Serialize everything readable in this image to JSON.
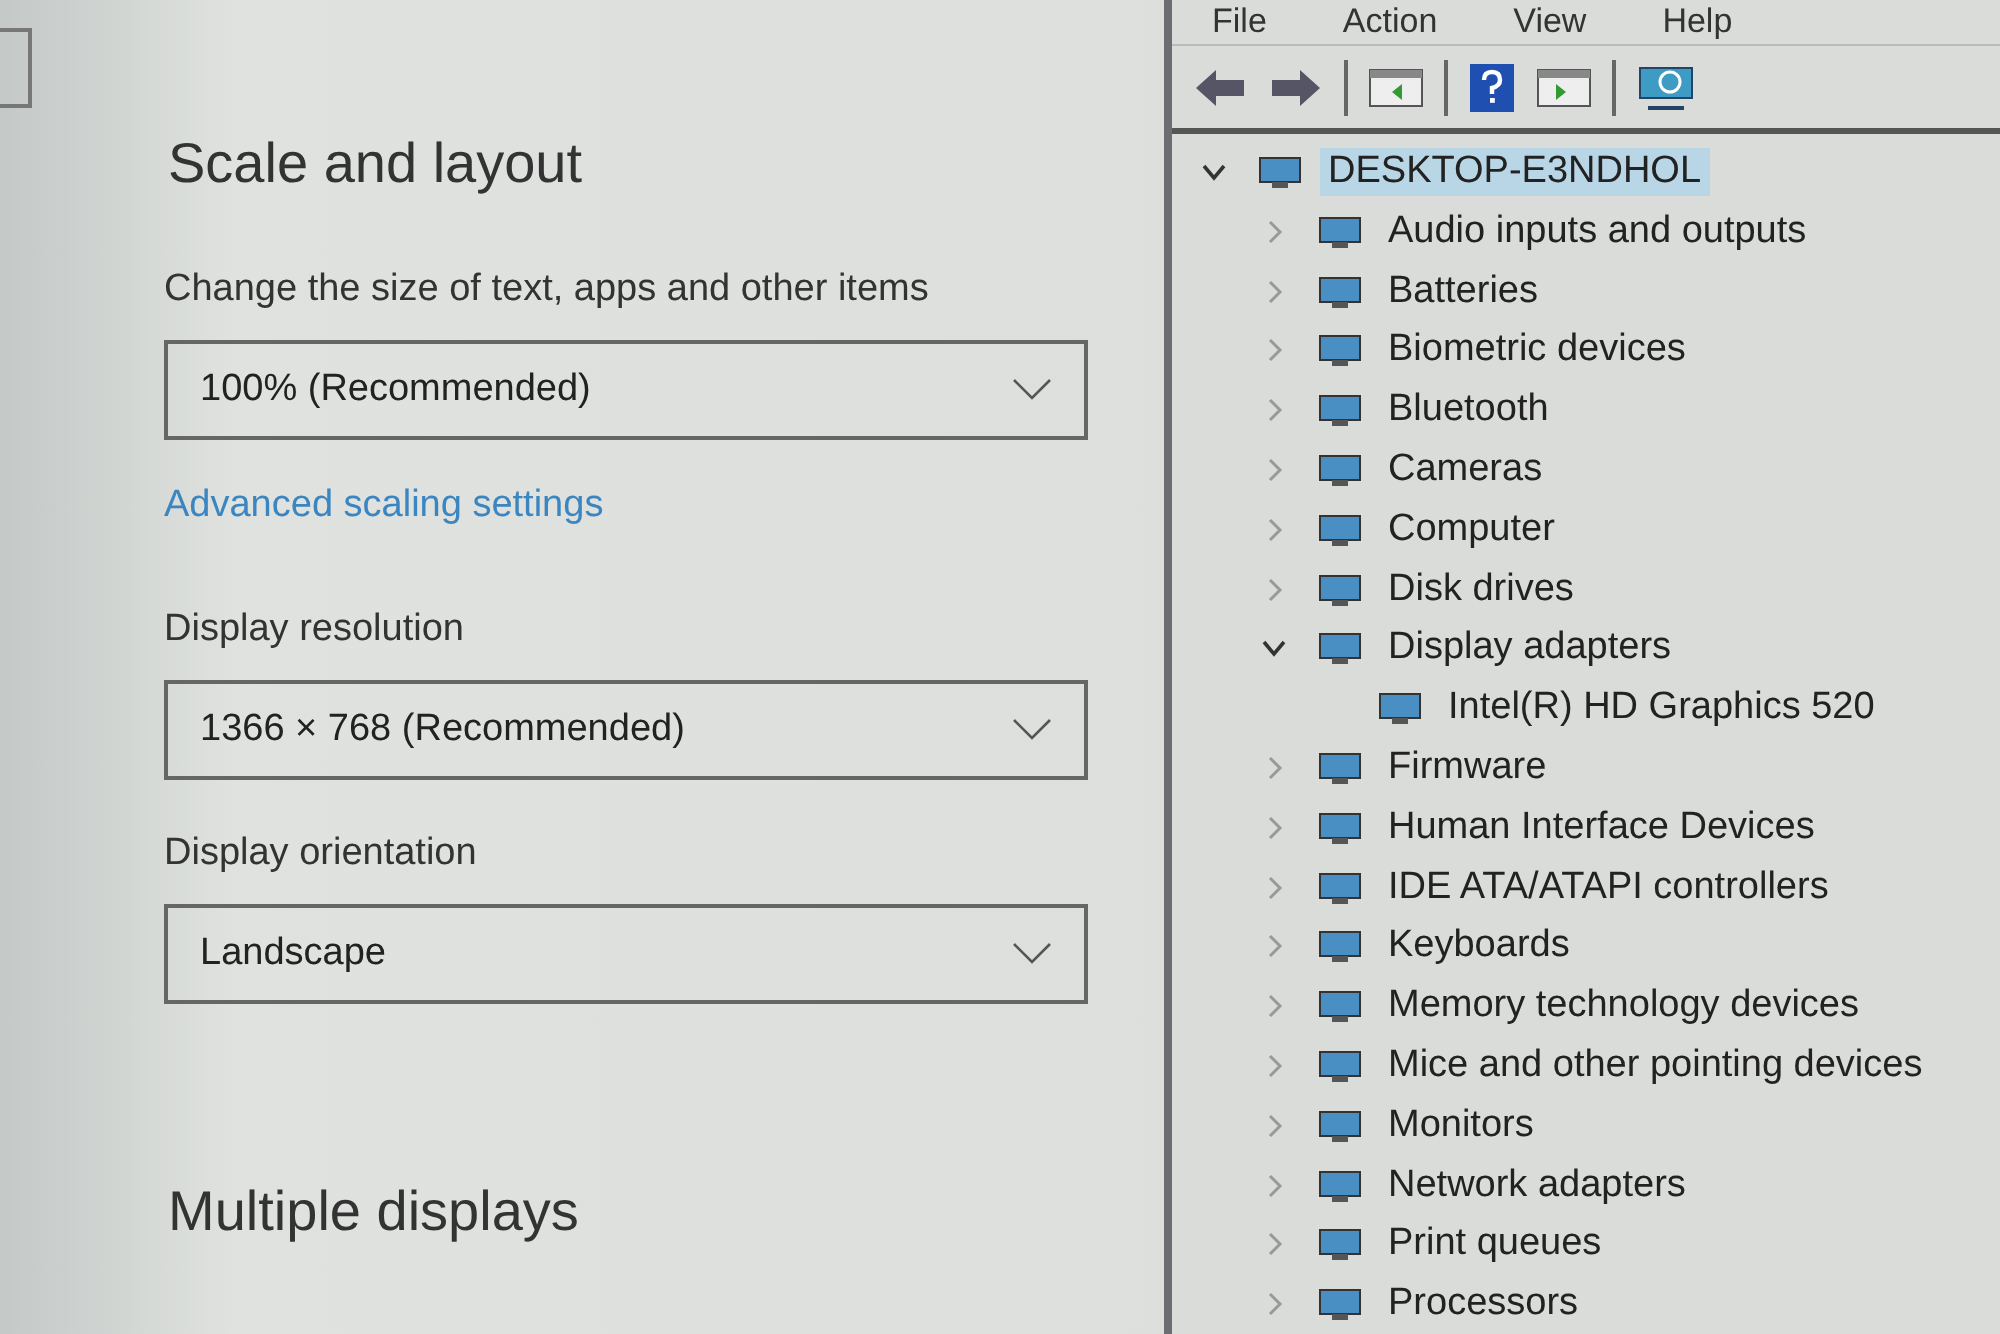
{
  "settings": {
    "heading": "Scale and layout",
    "scale_label": "Change the size of text, apps and other items",
    "scale_value": "100% (Recommended)",
    "advanced_link": "Advanced scaling settings",
    "resolution_label": "Display resolution",
    "resolution_value": "1366 × 768 (Recommended)",
    "orientation_label": "Display orientation",
    "orientation_value": "Landscape",
    "section_heading": "Multiple displays"
  },
  "device_manager": {
    "menu": [
      "File",
      "Action",
      "View",
      "Help"
    ],
    "tree": [
      {
        "label": "DESKTOP-E3NDHOL",
        "expanded": true,
        "selected": true,
        "children": [
          {
            "label": "Audio inputs and outputs",
            "expanded": false,
            "selected": false
          },
          {
            "label": "Batteries",
            "expanded": false,
            "selected": false
          },
          {
            "label": "Biometric devices",
            "expanded": false,
            "selected": false
          },
          {
            "label": "Bluetooth",
            "expanded": false,
            "selected": false
          },
          {
            "label": "Cameras",
            "expanded": false,
            "selected": false
          },
          {
            "label": "Computer",
            "expanded": false,
            "selected": false
          },
          {
            "label": "Disk drives",
            "expanded": false,
            "selected": false
          },
          {
            "label": "Display adapters",
            "expanded": true,
            "selected": false,
            "children": [
              {
                "label": "Intel(R) HD Graphics 520",
                "selected": false
              }
            ]
          },
          {
            "label": "Firmware",
            "expanded": false,
            "selected": false
          },
          {
            "label": "Human Interface Devices",
            "expanded": false,
            "selected": false
          },
          {
            "label": "IDE ATA/ATAPI controllers",
            "expanded": false,
            "selected": false
          },
          {
            "label": "Keyboards",
            "expanded": false,
            "selected": false
          },
          {
            "label": "Memory technology devices",
            "expanded": false,
            "selected": false
          },
          {
            "label": "Mice and other pointing devices",
            "expanded": false,
            "selected": false
          },
          {
            "label": "Monitors",
            "expanded": false,
            "selected": false
          },
          {
            "label": "Network adapters",
            "expanded": false,
            "selected": false
          },
          {
            "label": "Print queues",
            "expanded": false,
            "selected": false
          },
          {
            "label": "Processors",
            "expanded": false,
            "selected": false
          }
        ]
      }
    ]
  }
}
